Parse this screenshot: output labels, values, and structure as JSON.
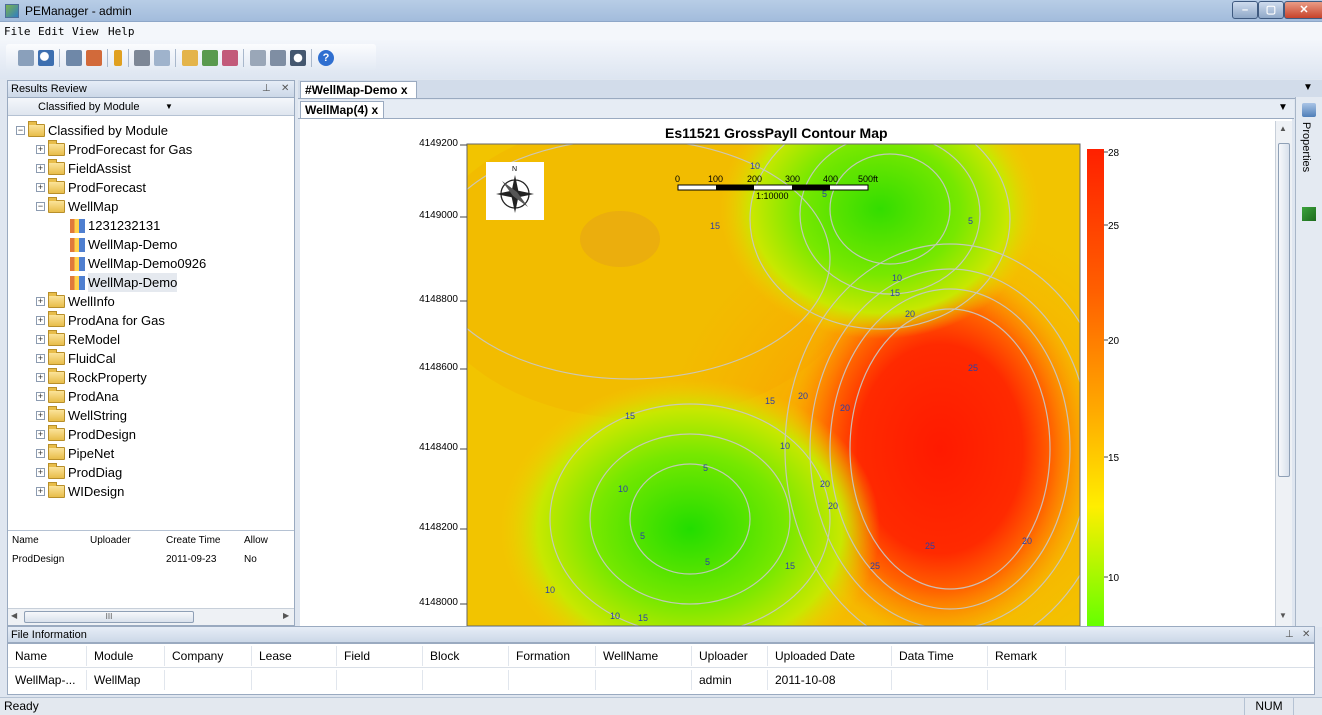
{
  "window": {
    "title": "PEManager - admin"
  },
  "menu": [
    "File",
    "Edit",
    "View",
    "Help"
  ],
  "results_panel": {
    "title": "Results Review",
    "combo_value": "Classified by Module",
    "tree": [
      {
        "label": "Classified by Module",
        "level": 0,
        "expanded": true,
        "icon": "folder-icon"
      },
      {
        "label": "ProdForecast for Gas",
        "level": 1,
        "icon": "folder-icon"
      },
      {
        "label": "FieldAssist",
        "level": 1,
        "icon": "folder-icon"
      },
      {
        "label": "ProdForecast",
        "level": 1,
        "icon": "folder-icon"
      },
      {
        "label": "WellMap",
        "level": 1,
        "expanded": true,
        "icon": "folder-icon"
      },
      {
        "label": "1231232131",
        "level": 2,
        "icon": "document-icon"
      },
      {
        "label": "WellMap-Demo",
        "level": 2,
        "icon": "document-icon"
      },
      {
        "label": "WellMap-Demo0926",
        "level": 2,
        "icon": "document-icon"
      },
      {
        "label": "WellMap-Demo",
        "level": 2,
        "icon": "document-icon",
        "selected": true
      },
      {
        "label": "WellInfo",
        "level": 1,
        "icon": "folder-icon"
      },
      {
        "label": "ProdAna for Gas",
        "level": 1,
        "icon": "folder-icon"
      },
      {
        "label": "ReModel",
        "level": 1,
        "icon": "folder-icon"
      },
      {
        "label": "FluidCal",
        "level": 1,
        "icon": "folder-icon"
      },
      {
        "label": "RockProperty",
        "level": 1,
        "icon": "folder-icon"
      },
      {
        "label": "ProdAna",
        "level": 1,
        "icon": "folder-icon"
      },
      {
        "label": "WellString",
        "level": 1,
        "icon": "folder-icon"
      },
      {
        "label": "ProdDesign",
        "level": 1,
        "icon": "folder-icon"
      },
      {
        "label": "PipeNet",
        "level": 1,
        "icon": "folder-icon"
      },
      {
        "label": "ProdDiag",
        "level": 1,
        "icon": "folder-icon"
      },
      {
        "label": "WIDesign",
        "level": 1,
        "icon": "folder-icon"
      }
    ],
    "file_table": {
      "columns": [
        "Name",
        "Uploader",
        "Create Time",
        "Allow"
      ],
      "rows": [
        [
          "ProdDesign",
          "",
          "2011-09-23",
          "No"
        ]
      ]
    },
    "hscroll_thumb": "III"
  },
  "tabs": {
    "outer": "#WellMap-Demo",
    "inner": "WellMap(4)",
    "close_glyph": "x"
  },
  "map": {
    "title": "Es11521 GrossPayll Contour Map",
    "y_ticks": [
      "4149200",
      "4149000",
      "4148800",
      "4148600",
      "4148400",
      "4148200",
      "4148000"
    ],
    "scale_labels": [
      "0",
      "100",
      "200",
      "300",
      "400",
      "500ft"
    ],
    "scale_ratio": "1:10000",
    "compass_label": "N",
    "colorbar_labels": [
      "28",
      "25",
      "20",
      "15",
      "10"
    ],
    "contour_labels": [
      "10",
      "5",
      "5",
      "10",
      "15",
      "15",
      "20",
      "25",
      "20",
      "20",
      "15",
      "10",
      "15",
      "10",
      "5",
      "5",
      "10",
      "5",
      "20",
      "20",
      "15",
      "20",
      "25",
      "25",
      "10",
      "15"
    ]
  },
  "right_sidebar": {
    "properties_label": "Properties"
  },
  "file_info": {
    "title": "File Information",
    "columns": [
      "Name",
      "Module",
      "Company",
      "Lease",
      "Field",
      "Block",
      "Formation",
      "WellName",
      "Uploader",
      "Uploaded Date",
      "Data Time",
      "Remark"
    ],
    "rows": [
      [
        "WellMap-...",
        "WellMap",
        "",
        "",
        "",
        "",
        "",
        "",
        "admin",
        "2011-10-08",
        "",
        ""
      ]
    ]
  },
  "status": {
    "left": "Ready",
    "right": "NUM"
  },
  "colors": {
    "accent": "#0055cc",
    "window_chrome": "#b8cde6",
    "colorbar_top": "#ff2000",
    "colorbar_bottom": "#66ff00"
  }
}
